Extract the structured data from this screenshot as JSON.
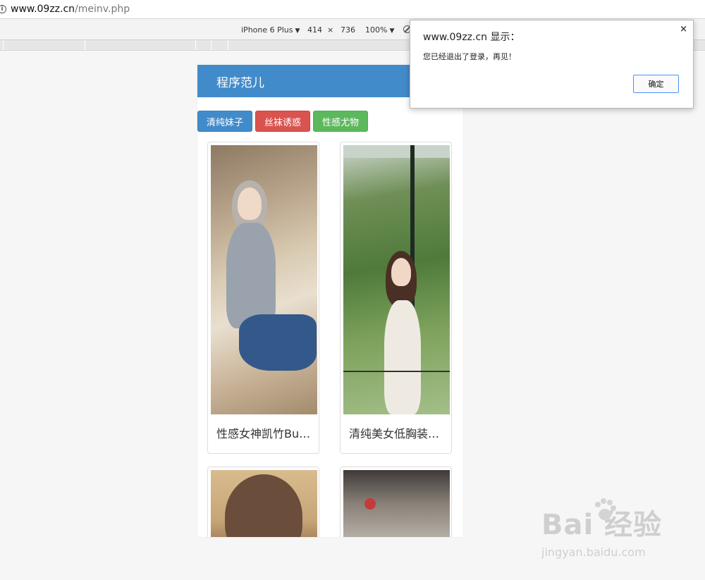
{
  "browser": {
    "url_host": "www.09zz.cn",
    "url_path": "/meinv.php"
  },
  "device_toolbar": {
    "device": "iPhone 6 Plus",
    "width": "414",
    "times": "×",
    "height": "736",
    "zoom": "100%"
  },
  "app": {
    "title": "程序范儿",
    "buttons": [
      {
        "label": "清纯妹子",
        "color": "#428bca"
      },
      {
        "label": "丝袜诱惑",
        "color": "#d9534f"
      },
      {
        "label": "性感尤物",
        "color": "#5cb85c"
      }
    ],
    "cards": [
      {
        "caption": "性感女神凯竹Bu…"
      },
      {
        "caption": "清纯美女低胸装…"
      },
      {
        "caption": ""
      },
      {
        "caption": ""
      }
    ]
  },
  "dialog": {
    "title": "www.09zz.cn 显示：",
    "message": "您已经退出了登录，再见！",
    "ok_label": "确定",
    "close_glyph": "×"
  },
  "watermark": {
    "brand": "Bai  经验",
    "url": "jingyan.baidu.com"
  }
}
